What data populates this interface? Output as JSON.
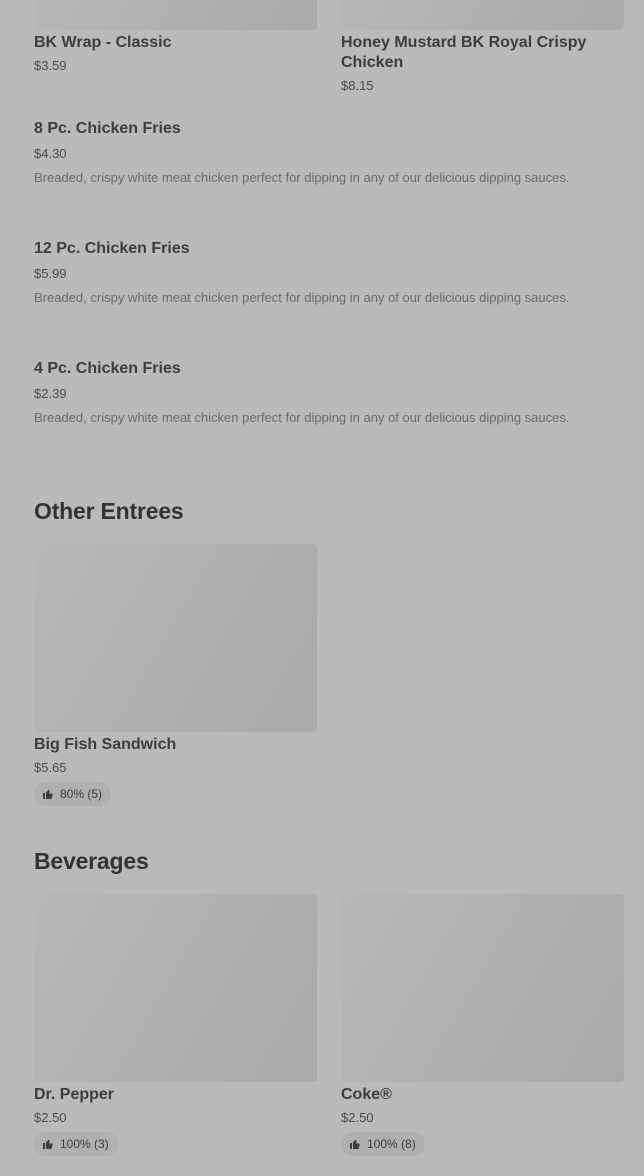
{
  "top_items": [
    {
      "name": "BK Wrap - Classic",
      "price": "$3.59"
    },
    {
      "name": "Honey Mustard BK Royal Crispy Chicken",
      "price": "$8.15"
    }
  ],
  "list_items": [
    {
      "name": "8 Pc. Chicken Fries",
      "price": "$4.30",
      "description": "Breaded, crispy white meat chicken perfect for dipping in any of our delicious dipping sauces."
    },
    {
      "name": "12 Pc. Chicken Fries",
      "price": "$5.99",
      "description": "Breaded, crispy white meat chicken perfect for dipping in any of our delicious dipping sauces."
    },
    {
      "name": "4 Pc. Chicken Fries",
      "price": "$2.39",
      "description": "Breaded, crispy white meat chicken perfect for dipping in any of our delicious dipping sauces."
    }
  ],
  "other_entrees": {
    "title": "Other Entrees",
    "items": [
      {
        "name": "Big Fish Sandwich",
        "price": "$5.65",
        "rating": "80% (5)"
      }
    ]
  },
  "beverages": {
    "title": "Beverages",
    "items": [
      {
        "name": "Dr. Pepper",
        "price": "$2.50",
        "rating": "100% (3)"
      },
      {
        "name": "Coke®",
        "price": "$2.50",
        "rating": "100% (8)"
      }
    ]
  },
  "icons": {
    "rating": "thumbs-up-icon"
  },
  "colors": {
    "overlay_background": "#bababa",
    "image_placeholder": "#b1b1b1"
  }
}
